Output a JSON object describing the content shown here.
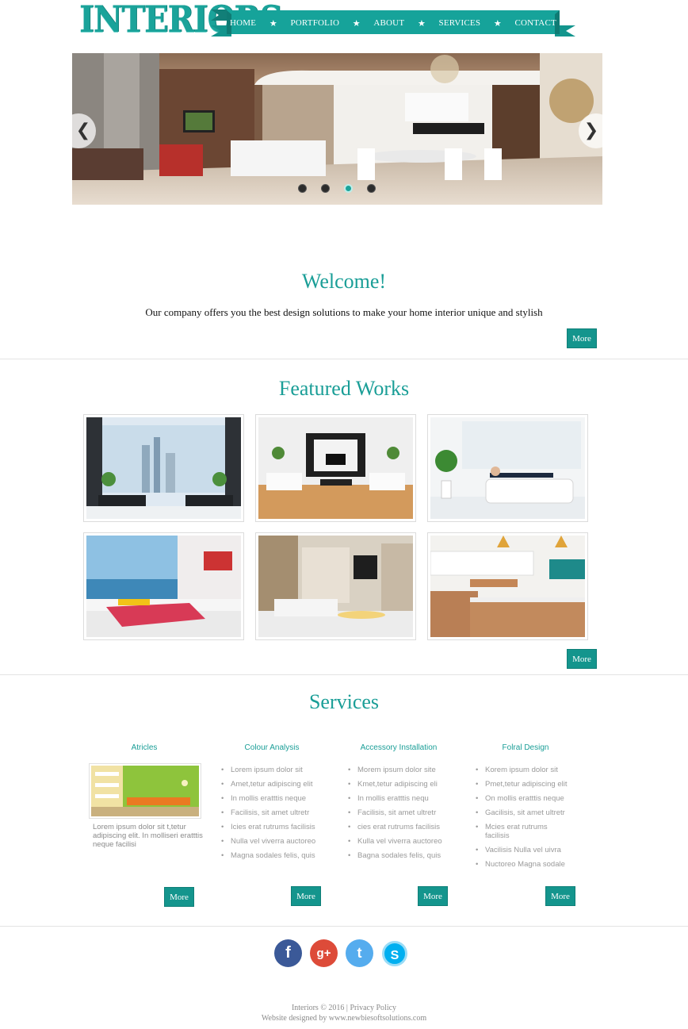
{
  "brand": {
    "logo_text": "INTERIORS"
  },
  "nav": {
    "items": [
      {
        "label": "HOME"
      },
      {
        "label": "PORTFOLIO"
      },
      {
        "label": "ABOUT"
      },
      {
        "label": "SERVICES"
      },
      {
        "label": "CONTACT"
      }
    ],
    "separator": "★"
  },
  "slider": {
    "prev_icon": "chevron-left-icon",
    "next_icon": "chevron-right-icon",
    "slide_count": 4,
    "active_slide": 3
  },
  "welcome": {
    "heading": "Welcome!",
    "text": "Our company offers you the best design solutions to make your home interior unique and stylish",
    "more_label": "More"
  },
  "featured": {
    "heading": "Featured Works",
    "more_label": "More"
  },
  "services": {
    "heading": "Services",
    "columns": [
      {
        "title": "Atricles",
        "description": "Lorem ipsum dolor sit t,tetur adipiscing elit. In molliseri eratttis neque facilisi",
        "more_label": "More"
      },
      {
        "title": "Colour Analysis",
        "items": [
          "Lorem ipsum dolor sit",
          "Amet,tetur adipiscing elit",
          "In mollis eratttis neque",
          "Facilisis, sit amet ultretr",
          "Icies erat rutrums facilisis",
          "Nulla vel viverra auctoreo",
          "Magna sodales felis, quis"
        ],
        "more_label": "More"
      },
      {
        "title": "Accessory Installation",
        "items": [
          "Morem ipsum dolor site",
          "Kmet,tetur adipiscing eli",
          "In mollis eratttis nequ",
          "Facilisis, sit amet ultretr",
          "cies erat rutrums facilisis",
          "Kulla vel viverra auctoreo",
          "Bagna sodales felis, quis"
        ],
        "more_label": "More"
      },
      {
        "title": "Folral Design",
        "items": [
          "Korem ipsum dolor sit",
          "Pmet,tetur adipiscing elit",
          "On mollis eratttis neque",
          "Gacilisis, sit amet ultretr",
          "Mcies erat rutrums facilisis",
          "Vacilisis Nulla vel uivra",
          "Nuctoreo Magna sodale"
        ],
        "more_label": "More"
      }
    ]
  },
  "social": [
    {
      "icon": "facebook-icon",
      "glyph": "f",
      "color": "#3b5998"
    },
    {
      "icon": "google-plus-icon",
      "glyph": "g+",
      "color": "#dd4b39"
    },
    {
      "icon": "twitter-icon",
      "glyph": "t",
      "color": "#55acee"
    },
    {
      "icon": "skype-icon",
      "glyph": "S",
      "color": "#00aff0"
    }
  ],
  "footer": {
    "copyright": "Interiors © 2016",
    "separator": "|",
    "privacy_label": "Privacy Policy",
    "credit_prefix": "Website designed by",
    "credit_link": "www.newbiesoftsolutions.com"
  },
  "colors": {
    "accent": "#1a9e97",
    "button": "#14958d"
  }
}
